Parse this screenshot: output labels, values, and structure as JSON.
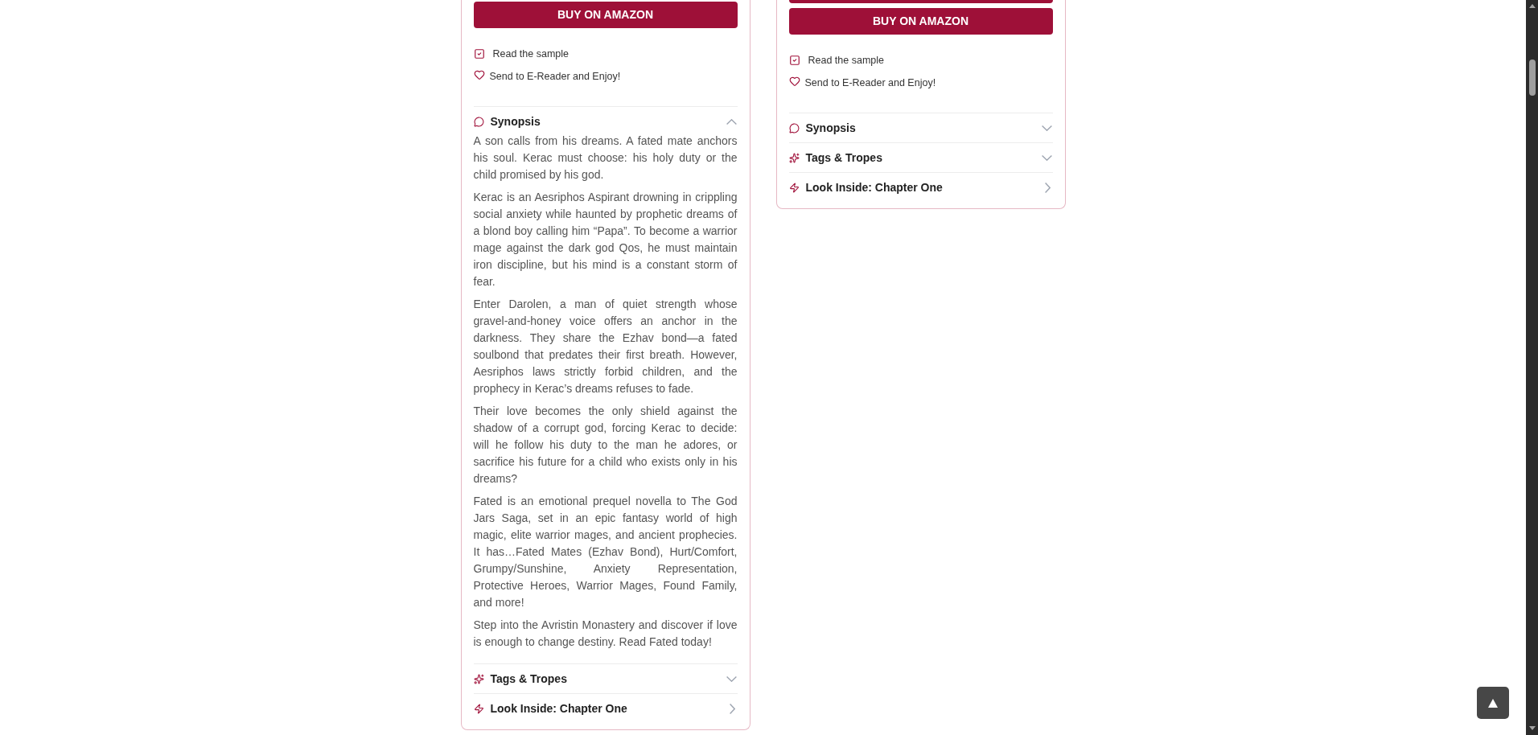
{
  "books": [
    {
      "cut_button_above": false,
      "buy_button": "BUY ON AMAZON",
      "links": [
        {
          "kind": "sample",
          "label": "Read the sample"
        },
        {
          "kind": "ereader",
          "label": "Send to E-Reader and Enjoy!"
        }
      ],
      "sections": [
        {
          "kind": "synopsis",
          "title": "Synopsis",
          "expanded": true,
          "paragraphs": [
            "A son calls from his dreams. A fated mate anchors his soul. Kerac must choose: his holy duty or the child promised by his god.",
            "Kerac is an Aesriphos Aspirant drowning in crippling social anxiety while haunted by prophetic dreams of a blond boy calling him “Papa”. To become a warrior mage against the dark god Qos, he must maintain iron discipline, but his mind is a constant storm of fear.",
            "Enter Darolen, a man of quiet strength whose gravel-and-honey voice offers an anchor in the darkness. They share the Ezhav bond—a fated soulbond that predates their first breath. However, Aesriphos laws strictly forbid children, and the prophecy in Kerac’s dreams refuses to fade.",
            "Their love becomes the only shield against the shadow of a corrupt god, forcing Kerac to decide: will he follow his duty to the man he adores, or sacrifice his future for a child who exists only in his dreams?",
            "Fated is an emotional prequel novella to The God Jars Saga, set in an epic fantasy world of high magic, elite warrior mages, and ancient prophecies. It has…Fated Mates (Ezhav Bond), Hurt/Comfort, Grumpy/Sunshine, Anxiety Representation, Protective Heroes, Warrior Mages, Found Family, and more!",
            "Step into the Avristin Monastery and discover if love is enough to change destiny. Read Fated today!"
          ]
        },
        {
          "kind": "tags",
          "title": "Tags & Tropes",
          "expanded": false
        },
        {
          "kind": "chapter",
          "title": "Look Inside: Chapter One"
        }
      ]
    },
    {
      "cut_button_above": true,
      "buy_button": "BUY ON AMAZON",
      "links": [
        {
          "kind": "sample",
          "label": "Read the sample"
        },
        {
          "kind": "ereader",
          "label": "Send to E-Reader and Enjoy!"
        }
      ],
      "sections": [
        {
          "kind": "synopsis",
          "title": "Synopsis",
          "expanded": false
        },
        {
          "kind": "tags",
          "title": "Tags & Tropes",
          "expanded": false
        },
        {
          "kind": "chapter",
          "title": "Look Inside: Chapter One"
        }
      ]
    }
  ]
}
